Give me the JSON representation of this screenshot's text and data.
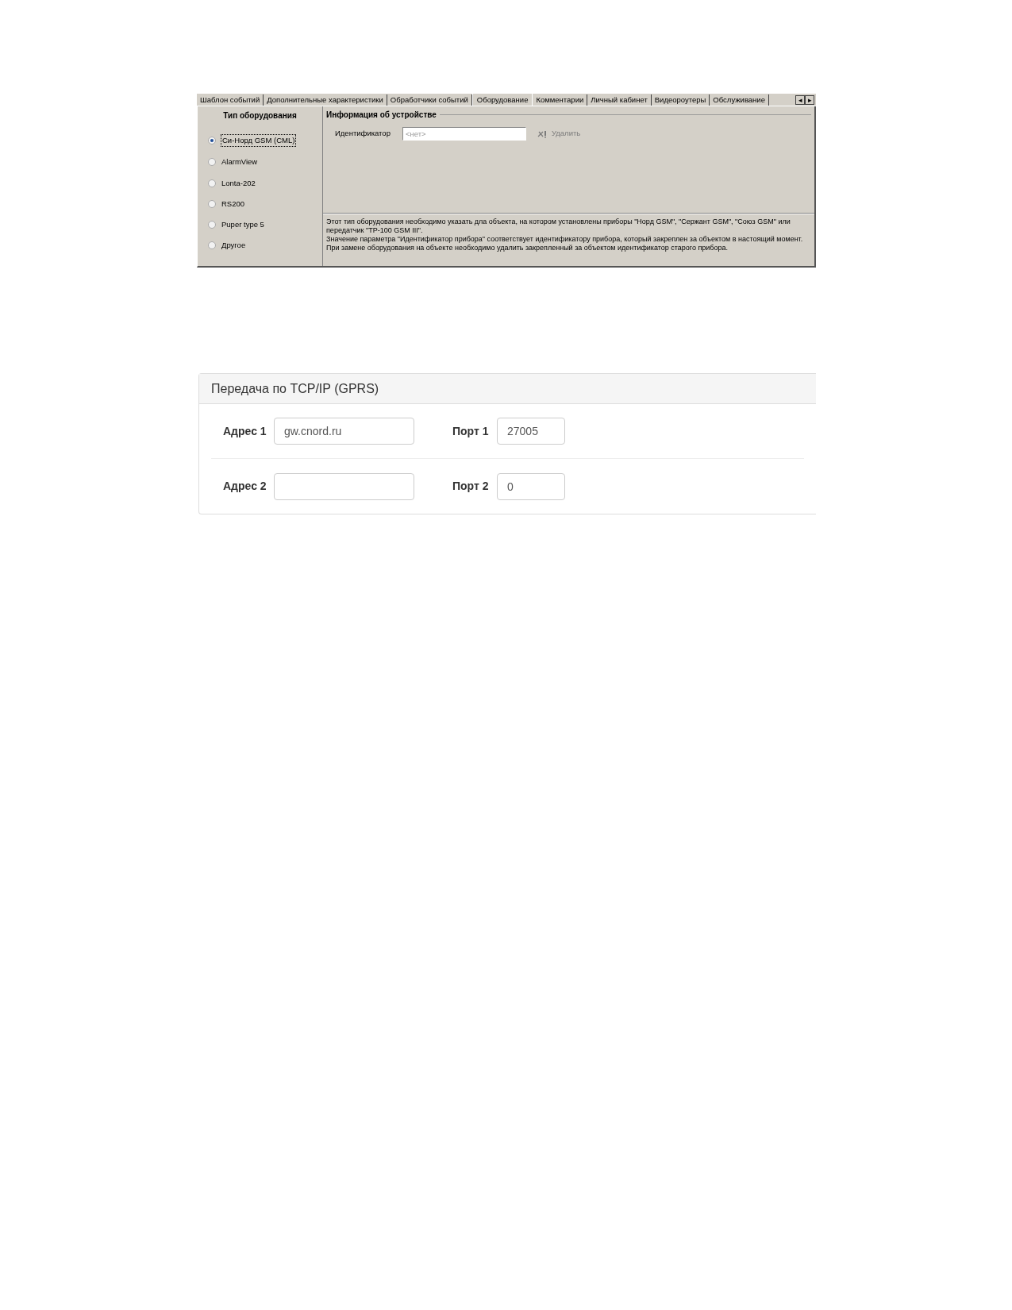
{
  "equipment_dialog": {
    "tabs": [
      {
        "label": "Шаблон событий",
        "selected": false
      },
      {
        "label": "Дополнительные характеристики",
        "selected": false
      },
      {
        "label": "Обработчики событий",
        "selected": false
      },
      {
        "label": "Оборудование",
        "selected": true
      },
      {
        "label": "Комментарии",
        "selected": false
      },
      {
        "label": "Личный кабинет",
        "selected": false
      },
      {
        "label": "Видеороутеры",
        "selected": false
      },
      {
        "label": "Обслуживание",
        "selected": false
      }
    ],
    "tab_scroll": {
      "left": "◂",
      "right": "▸"
    },
    "equipment_type": {
      "title": "Тип оборудования",
      "options": [
        {
          "label": "Си-Норд GSM (CML)",
          "selected": true
        },
        {
          "label": "AlarmView",
          "selected": false
        },
        {
          "label": "Lonta-202",
          "selected": false
        },
        {
          "label": "RS200",
          "selected": false
        },
        {
          "label": "Puper type 5",
          "selected": false
        },
        {
          "label": "Другое",
          "selected": false
        }
      ]
    },
    "device_info": {
      "title": "Информация об устройстве",
      "identifier_label": "Идентификатор",
      "identifier_placeholder": "<нет>",
      "delete_button": {
        "label": "Удалить",
        "disabled": true
      }
    },
    "description": [
      "Этот тип оборудования необходимо указать дла объекта, на котором установлены приборы \"Норд GSM\", \"Сержант GSM\", \"Союз GSM\" или передатчик \"ТР-100 GSM III\".",
      "Значение параметра \"Идентификатор прибора\" соответствует идентификатору прибора, который закреплен за объектом в настоящий момент.",
      "При замене оборудования на объекте необходимо удалить закрепленный за объектом идентификатор старого прибора."
    ]
  },
  "tcp_panel": {
    "title": "Передача по TCP/IP (GPRS)",
    "rows": [
      {
        "address_label": "Адрес 1",
        "address_value": "gw.cnord.ru",
        "port_label": "Порт 1",
        "port_value": "27005"
      },
      {
        "address_label": "Адрес 2",
        "port_label": "Порт 2",
        "port_value": "0"
      }
    ]
  }
}
